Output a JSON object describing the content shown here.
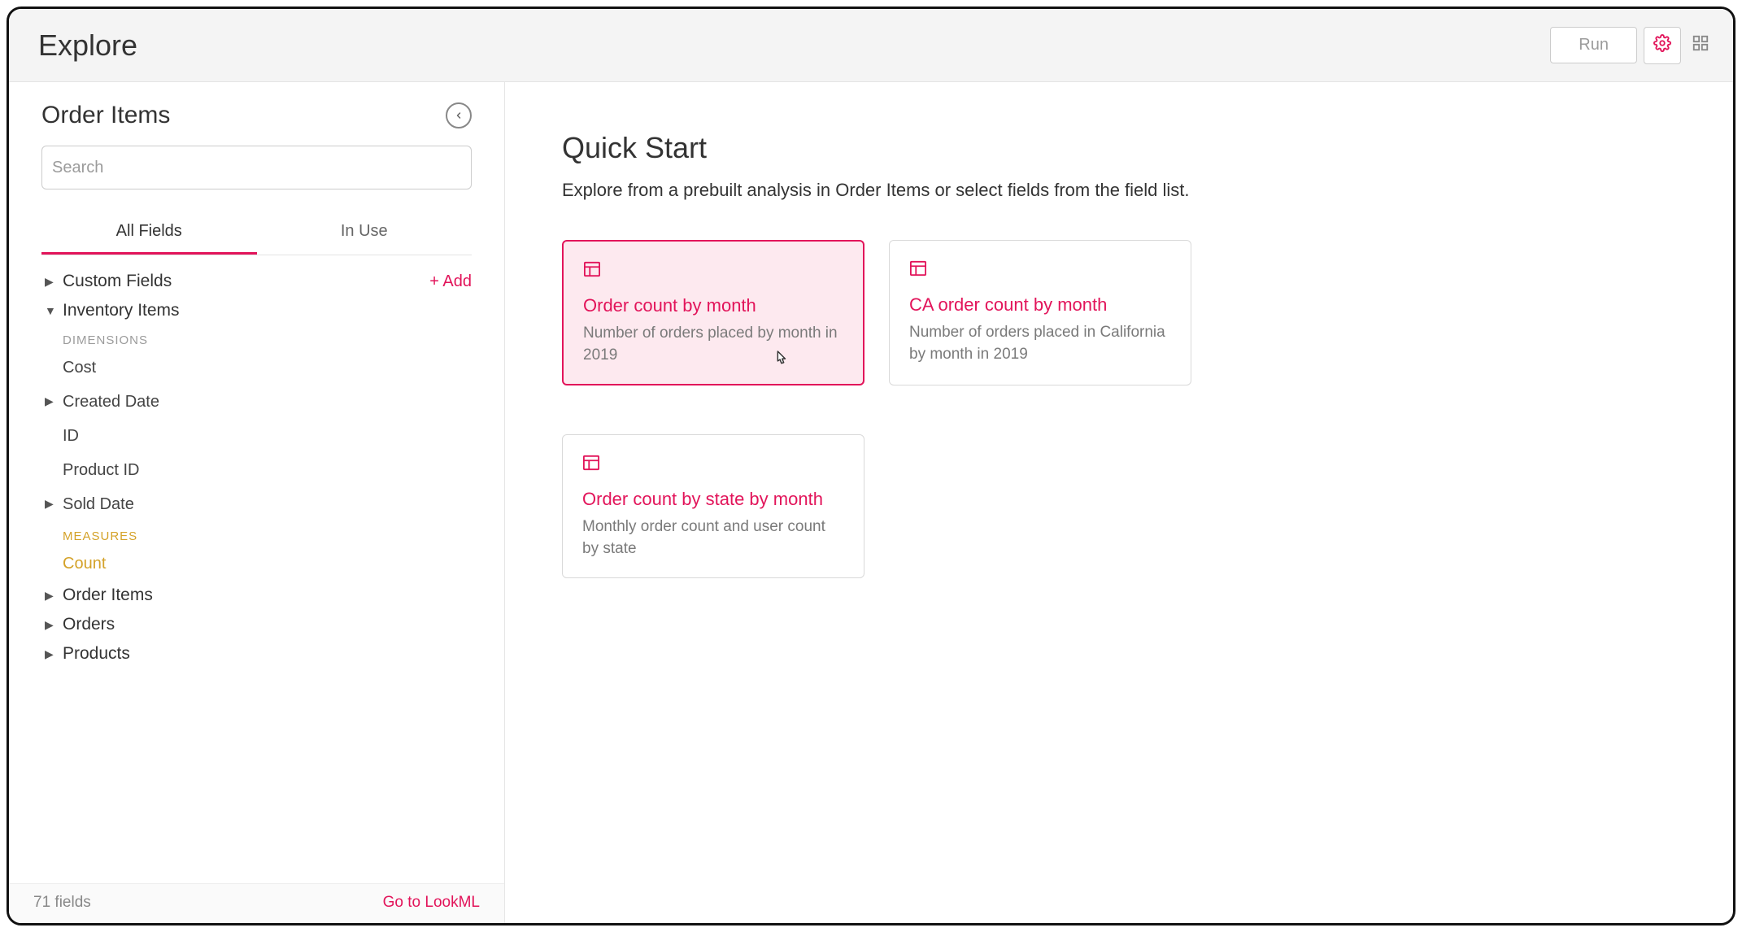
{
  "header": {
    "title": "Explore",
    "run_label": "Run"
  },
  "sidebar": {
    "title": "Order Items",
    "search_placeholder": "Search",
    "tabs": {
      "all_fields": "All Fields",
      "in_use": "In Use"
    },
    "add_label": "Add",
    "sections": {
      "custom_fields": "Custom Fields",
      "inventory_items": "Inventory Items",
      "order_items": "Order Items",
      "orders": "Orders",
      "products": "Products"
    },
    "labels": {
      "dimensions": "DIMENSIONS",
      "measures": "MEASURES"
    },
    "inventory_dims": {
      "cost": "Cost",
      "created_date": "Created Date",
      "id": "ID",
      "product_id": "Product ID",
      "sold_date": "Sold Date"
    },
    "inventory_measures": {
      "count": "Count"
    },
    "footer": {
      "fields": "71 fields",
      "lookml": "Go to LookML"
    }
  },
  "main": {
    "title": "Quick Start",
    "subtitle": "Explore from a prebuilt analysis in Order Items or select fields from the field list.",
    "cards": [
      {
        "title": "Order count by month",
        "desc": "Number of orders placed by month in 2019"
      },
      {
        "title": "CA order count by month",
        "desc": "Number of orders placed in California by month in 2019"
      },
      {
        "title": "Order count by state by month",
        "desc": "Monthly order count and user count by state"
      }
    ]
  }
}
